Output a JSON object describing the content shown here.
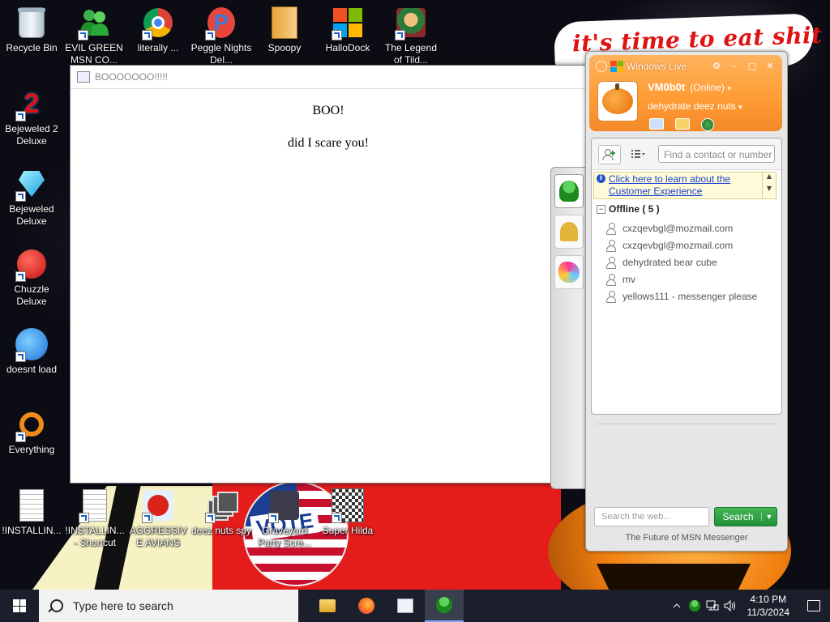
{
  "desktop": {
    "wallpaper_text": "it's time to eat shit",
    "icons": [
      {
        "id": "recycle-bin",
        "label": "Recycle Bin"
      },
      {
        "id": "evil-green",
        "label": "EVIL GREEN MSN CO..."
      },
      {
        "id": "literally",
        "label": "literally ..."
      },
      {
        "id": "peggle",
        "label": "Peggle Nights Del..."
      },
      {
        "id": "spoopy",
        "label": "Spoopy"
      },
      {
        "id": "hallodock",
        "label": "HalloDock"
      },
      {
        "id": "legend",
        "label": "The Legend of Tild..."
      },
      {
        "id": "bejeweled2",
        "label": "Bejeweled 2 Deluxe"
      },
      {
        "id": "bejeweled",
        "label": "Bejeweled Deluxe"
      },
      {
        "id": "chuzzle",
        "label": "Chuzzle Deluxe"
      },
      {
        "id": "doesnt-load",
        "label": "doesnt load"
      },
      {
        "id": "everything",
        "label": "Everything"
      },
      {
        "id": "installin",
        "label": "!INSTALLIN..."
      },
      {
        "id": "installin-shortcut",
        "label": "!INSTALLIN... - Shortcut"
      },
      {
        "id": "aggressive-avians",
        "label": "AGGRESSIVE AVIANS"
      },
      {
        "id": "deez-nuts",
        "label": "deez nuts spy"
      },
      {
        "id": "graveyard",
        "label": "Graveyard Party Scre..."
      },
      {
        "id": "super-hilda",
        "label": "Super Hilda"
      }
    ],
    "vote_badge_text": "VOTE"
  },
  "boo_window": {
    "title": "BOOOOOOO!!!!!",
    "line1": "BOO!",
    "line2": "did I scare you!"
  },
  "msn": {
    "brand": "Windows Live",
    "window_controls": {
      "settings": "⚙",
      "minimize": "–",
      "maximize": "□",
      "close": "✕"
    },
    "username": "VM0b0t",
    "status": "(Online)",
    "personal_message": "dehydrate deez nuts",
    "find_placeholder": "Find a contact or number",
    "banner_link": "Click here to learn about the Customer Experience",
    "group_label": "Offline ( 5 )",
    "contacts": [
      "cxzqevbgl@mozmail.com",
      "cxzqevbgl@mozmail.com",
      "dehydrated bear cube",
      "mv",
      "yellows111 - messenger please"
    ],
    "web_search_placeholder": "Search the web...",
    "search_button": "Search",
    "footer": "The Future of MSN Messenger"
  },
  "taskbar": {
    "search_placeholder": "Type here to search",
    "time": "4:10 PM",
    "date": "11/3/2024"
  }
}
